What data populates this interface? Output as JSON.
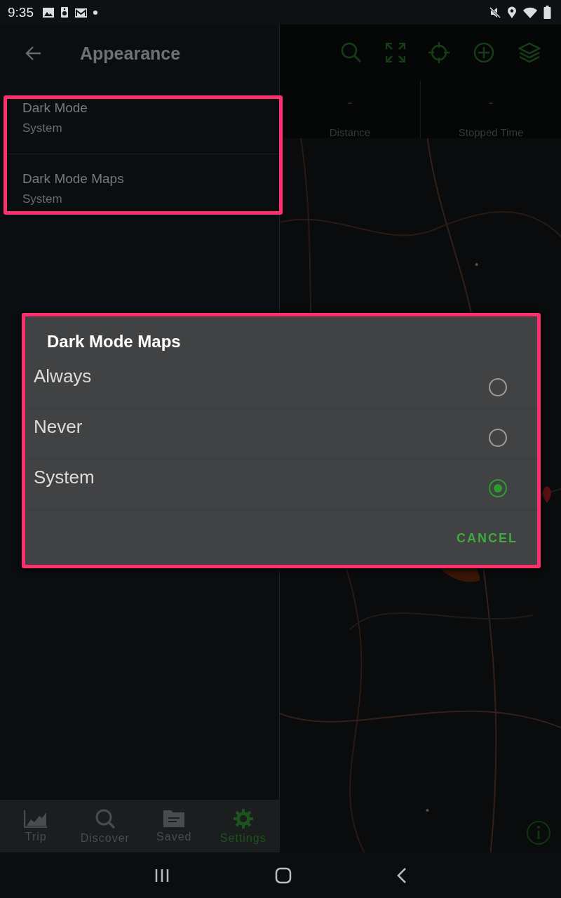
{
  "status_bar": {
    "time": "9:35"
  },
  "header": {
    "title": "Appearance"
  },
  "settings": [
    {
      "title": "Dark Mode",
      "value": "System"
    },
    {
      "title": "Dark Mode Maps",
      "value": "System"
    }
  ],
  "stats": [
    {
      "value": "-",
      "label": "Distance"
    },
    {
      "value": "-",
      "label": "Stopped Time"
    }
  ],
  "bottom_nav": [
    {
      "label": "Trip",
      "selected": false
    },
    {
      "label": "Discover",
      "selected": false
    },
    {
      "label": "Saved",
      "selected": false
    },
    {
      "label": "Settings",
      "selected": true
    }
  ],
  "dialog": {
    "title": "Dark Mode Maps",
    "options": [
      {
        "label": "Always",
        "selected": false
      },
      {
        "label": "Never",
        "selected": false
      },
      {
        "label": "System",
        "selected": true
      }
    ],
    "button": "CANCEL"
  }
}
